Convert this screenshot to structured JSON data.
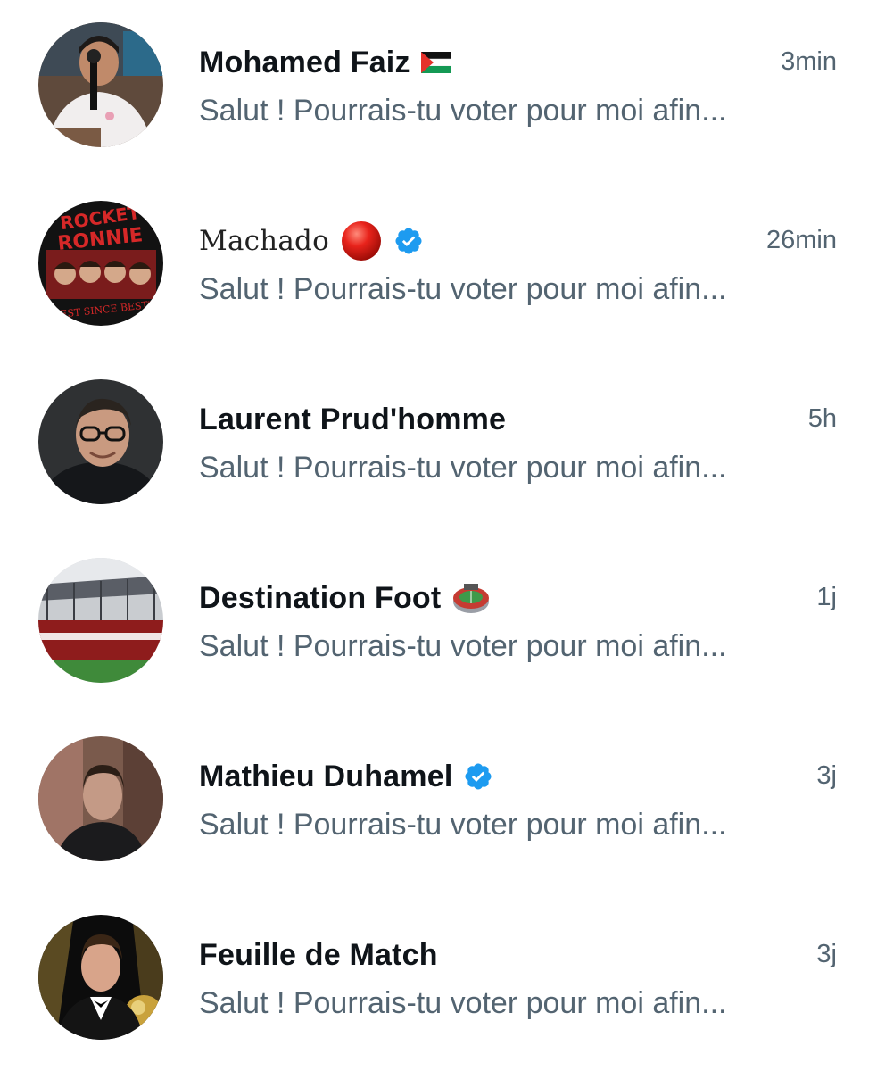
{
  "conversations": [
    {
      "name": "Mohamed Faiz",
      "time": "3min",
      "preview": "Salut ! Pourrais-tu voter pour moi afin...",
      "badges": [
        "palestine-flag-icon"
      ]
    },
    {
      "name": "Machado",
      "time": "26min",
      "preview": "Salut ! Pourrais-tu voter pour moi afin...",
      "badges": [
        "red-circle-icon",
        "verified-badge-icon"
      ],
      "avatar_text": [
        "ROCKET",
        "RONNIE",
        "\"BEST SINCE BEST\""
      ]
    },
    {
      "name": "Laurent Prud'homme",
      "time": "5h",
      "preview": "Salut ! Pourrais-tu voter pour moi afin...",
      "badges": []
    },
    {
      "name": "Destination Foot",
      "time": "1j",
      "preview": "Salut ! Pourrais-tu voter pour moi afin...",
      "badges": [
        "stadium-icon"
      ]
    },
    {
      "name": "Mathieu Duhamel",
      "time": "3j",
      "preview": "Salut ! Pourrais-tu voter pour moi afin...",
      "badges": [
        "verified-badge-icon"
      ]
    },
    {
      "name": "Feuille de Match",
      "time": "3j",
      "preview": "Salut ! Pourrais-tu voter pour moi afin...",
      "badges": []
    }
  ],
  "colors": {
    "name": "#0f1419",
    "secondary_text": "#536471",
    "verified_blue": "#1d9bf0",
    "background": "#ffffff"
  }
}
